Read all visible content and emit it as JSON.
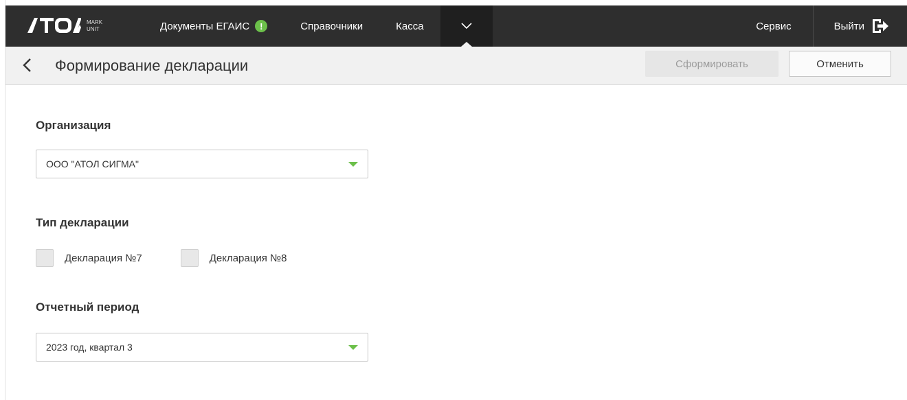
{
  "topbar": {
    "logo": {
      "brand": "ATOL",
      "sub1": "MARK",
      "sub2": "UNIT"
    },
    "nav": [
      {
        "label": "Документы ЕГАИС",
        "icon": "warning-icon",
        "badge": "!"
      },
      {
        "label": "Справочники"
      },
      {
        "label": "Касса"
      }
    ],
    "more_icon": "chevron-down-icon",
    "service_label": "Сервис",
    "logout_label": "Выйти",
    "logout_icon": "logout-icon",
    "accent": "#6cc04a"
  },
  "page": {
    "title": "Формирование декларации",
    "form_button": "Сформировать",
    "cancel_button": "Отменить"
  },
  "form": {
    "organization": {
      "label": "Организация",
      "value": "ООО \"АТОЛ СИГМА\""
    },
    "declaration_type": {
      "label": "Тип декларации",
      "options": [
        {
          "label": "Декларация №7",
          "checked": false
        },
        {
          "label": "Декларация №8",
          "checked": false
        }
      ]
    },
    "period": {
      "label": "Отчетный период",
      "value": "2023 год, квартал 3"
    }
  }
}
